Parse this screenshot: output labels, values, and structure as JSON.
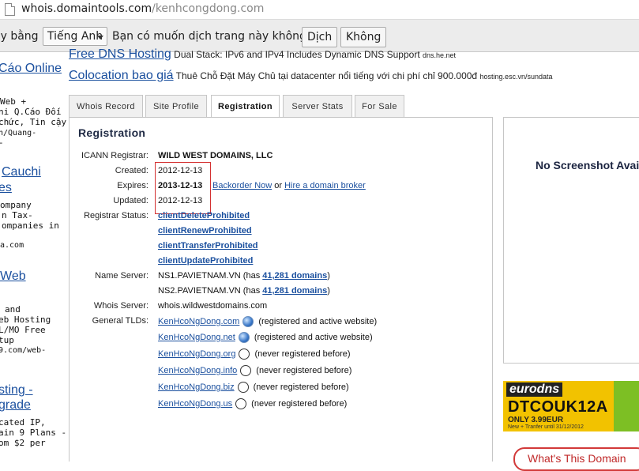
{
  "browser": {
    "url_host": "whois.domaintools.com",
    "url_path": "/kenhcongdong.com"
  },
  "translate_bar": {
    "prefix_text": "ày bằng",
    "language": "Tiếng Anh",
    "question": "Bạn có muốn dịch trang này không?",
    "translate_button": "Dịch",
    "decline_button": "Không"
  },
  "left_ads": {
    "link1": "Cáo Online",
    "text1": [
      "Web +",
      "ni Q.Cáo Đối",
      "chức, Tin cậy",
      "n/Quang-",
      "-"
    ],
    "link2a": "Cauchi",
    "link2b": "es",
    "text2": [
      "ompany",
      "n Tax-",
      "ompanies in",
      "",
      "a.com"
    ],
    "link3": "Web",
    "text3": [
      "and",
      "eb Hosting",
      "L/MO Free",
      "tup",
      "9.com/web-"
    ],
    "link4a": "sting -",
    "link4b": "grade",
    "text4": [
      "cated IP,",
      "ain 9 Plans -",
      "om $2 per"
    ]
  },
  "top_ads": [
    {
      "title": "Free DNS Hosting",
      "desc": "Dual Stack: IPv6 and IPv4 Includes Dynamic DNS Support",
      "source": "dns.he.net"
    },
    {
      "title": "Colocation bao giá",
      "desc": "Thuê Chỗ Đặt Máy Chủ tại datacenter nổi tiếng với chi phí chỉ 900.000đ",
      "source": "hosting.esc.vn/sundata"
    }
  ],
  "tabs": [
    "Whois Record",
    "Site Profile",
    "Registration",
    "Server Stats",
    "For Sale"
  ],
  "registration": {
    "heading": "Registration",
    "labels": {
      "registrar": "ICANN Registrar:",
      "created": "Created:",
      "expires": "Expires:",
      "updated": "Updated:",
      "status": "Registrar Status:",
      "nameserver": "Name Server:",
      "whois": "Whois Server:",
      "tlds": "General TLDs:"
    },
    "registrar": "WILD WEST DOMAINS, LLC",
    "created": "2012-12-13",
    "expires": "2013-12-13",
    "updated": "2012-12-13",
    "backorder_link": "Backorder Now",
    "or_text": "or",
    "hire_link": "Hire a domain broker",
    "statuses": [
      "clientDeleteProhibited",
      "clientRenewProhibited",
      "clientTransferProhibited",
      "clientUpdateProhibited"
    ],
    "nameservers": [
      {
        "host": "NS1.PAVIETNAM.VN",
        "pre": "(has",
        "count_link": "41,281 domains",
        "post": ")"
      },
      {
        "host": "NS2.PAVIETNAM.VN",
        "pre": "(has",
        "count_link": "41,281 domains",
        "post": ")"
      }
    ],
    "whois_server": "whois.wildwestdomains.com",
    "tlds": [
      {
        "domain": "KenHcoNgDong.com",
        "icon": "globe-icon",
        "note": "(registered and active website)"
      },
      {
        "domain": "KenHcoNgDong.net",
        "icon": "globe-icon",
        "note": "(registered and active website)"
      },
      {
        "domain": "KenHcoNgDong.org",
        "icon": "circle-icon",
        "note": "(never registered before)"
      },
      {
        "domain": "KenHcoNgDong.info",
        "icon": "circle-icon",
        "note": "(never registered before)"
      },
      {
        "domain": "KenHcoNgDong.biz",
        "icon": "circle-icon",
        "note": "(never registered before)"
      },
      {
        "domain": "KenHcoNgDong.us",
        "icon": "circle-icon",
        "note": "(never registered before)"
      }
    ]
  },
  "right": {
    "no_screenshot": "No Screenshot Avai",
    "banner_logo": "eurodns",
    "banner_code": "DTCOUK12A",
    "banner_price": "ONLY 3.99EUR",
    "banner_tiny": "New + Tranfer until 31/12/2012",
    "what_button": "What's This Domain"
  }
}
